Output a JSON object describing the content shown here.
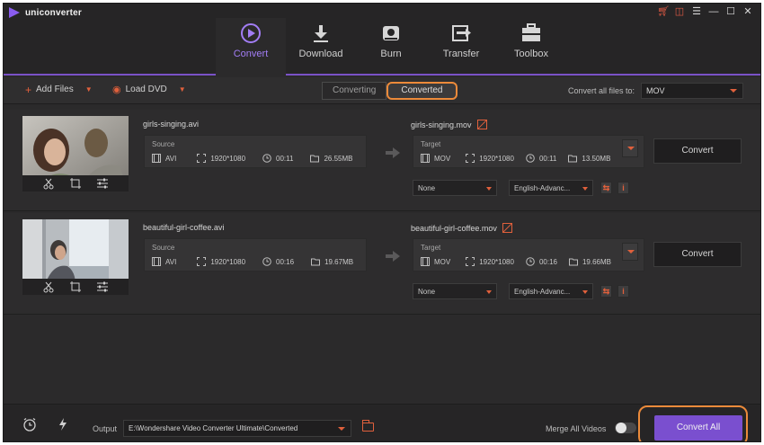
{
  "app": {
    "name": "uniconverter"
  },
  "window_controls": [
    "cart-icon",
    "gift-icon",
    "menu-icon",
    "minimize-icon",
    "maximize-icon",
    "close-icon"
  ],
  "nav": [
    {
      "label": "Convert",
      "icon": "convert-icon",
      "active": true
    },
    {
      "label": "Download",
      "icon": "download-icon",
      "active": false
    },
    {
      "label": "Burn",
      "icon": "burn-icon",
      "active": false
    },
    {
      "label": "Transfer",
      "icon": "transfer-icon",
      "active": false
    },
    {
      "label": "Toolbox",
      "icon": "toolbox-icon",
      "active": false
    }
  ],
  "toolbar": {
    "add_files": "Add Files",
    "load_dvd": "Load DVD",
    "tab_converting": "Converting",
    "tab_converted": "Converted",
    "convert_all_to_label": "Convert all files to:",
    "format_value": "MOV"
  },
  "files": [
    {
      "source_name": "girls-singing.avi",
      "target_name": "girls-singing.mov",
      "source": {
        "title": "Source",
        "format": "AVI",
        "resolution": "1920*1080",
        "duration": "00:11",
        "size": "26.55MB"
      },
      "target": {
        "title": "Target",
        "format": "MOV",
        "resolution": "1920*1080",
        "duration": "00:11",
        "size": "13.50MB"
      },
      "subtitle": "None",
      "audio": "English-Advanc...",
      "convert_label": "Convert"
    },
    {
      "source_name": "beautiful-girl-coffee.avi",
      "target_name": "beautiful-girl-coffee.mov",
      "source": {
        "title": "Source",
        "format": "AVI",
        "resolution": "1920*1080",
        "duration": "00:16",
        "size": "19.67MB"
      },
      "target": {
        "title": "Target",
        "format": "MOV",
        "resolution": "1920*1080",
        "duration": "00:16",
        "size": "19.66MB"
      },
      "subtitle": "None",
      "audio": "English-Advanc...",
      "convert_label": "Convert"
    }
  ],
  "bottom": {
    "output_label": "Output",
    "output_path": "E:\\Wondershare Video Converter Ultimate\\Converted",
    "merge_label": "Merge All Videos",
    "merge_enabled": false,
    "convert_all": "Convert All"
  },
  "colors": {
    "accent": "#7a4fcf",
    "highlight": "#ec8a3a",
    "orange_icon": "#e0603c"
  }
}
